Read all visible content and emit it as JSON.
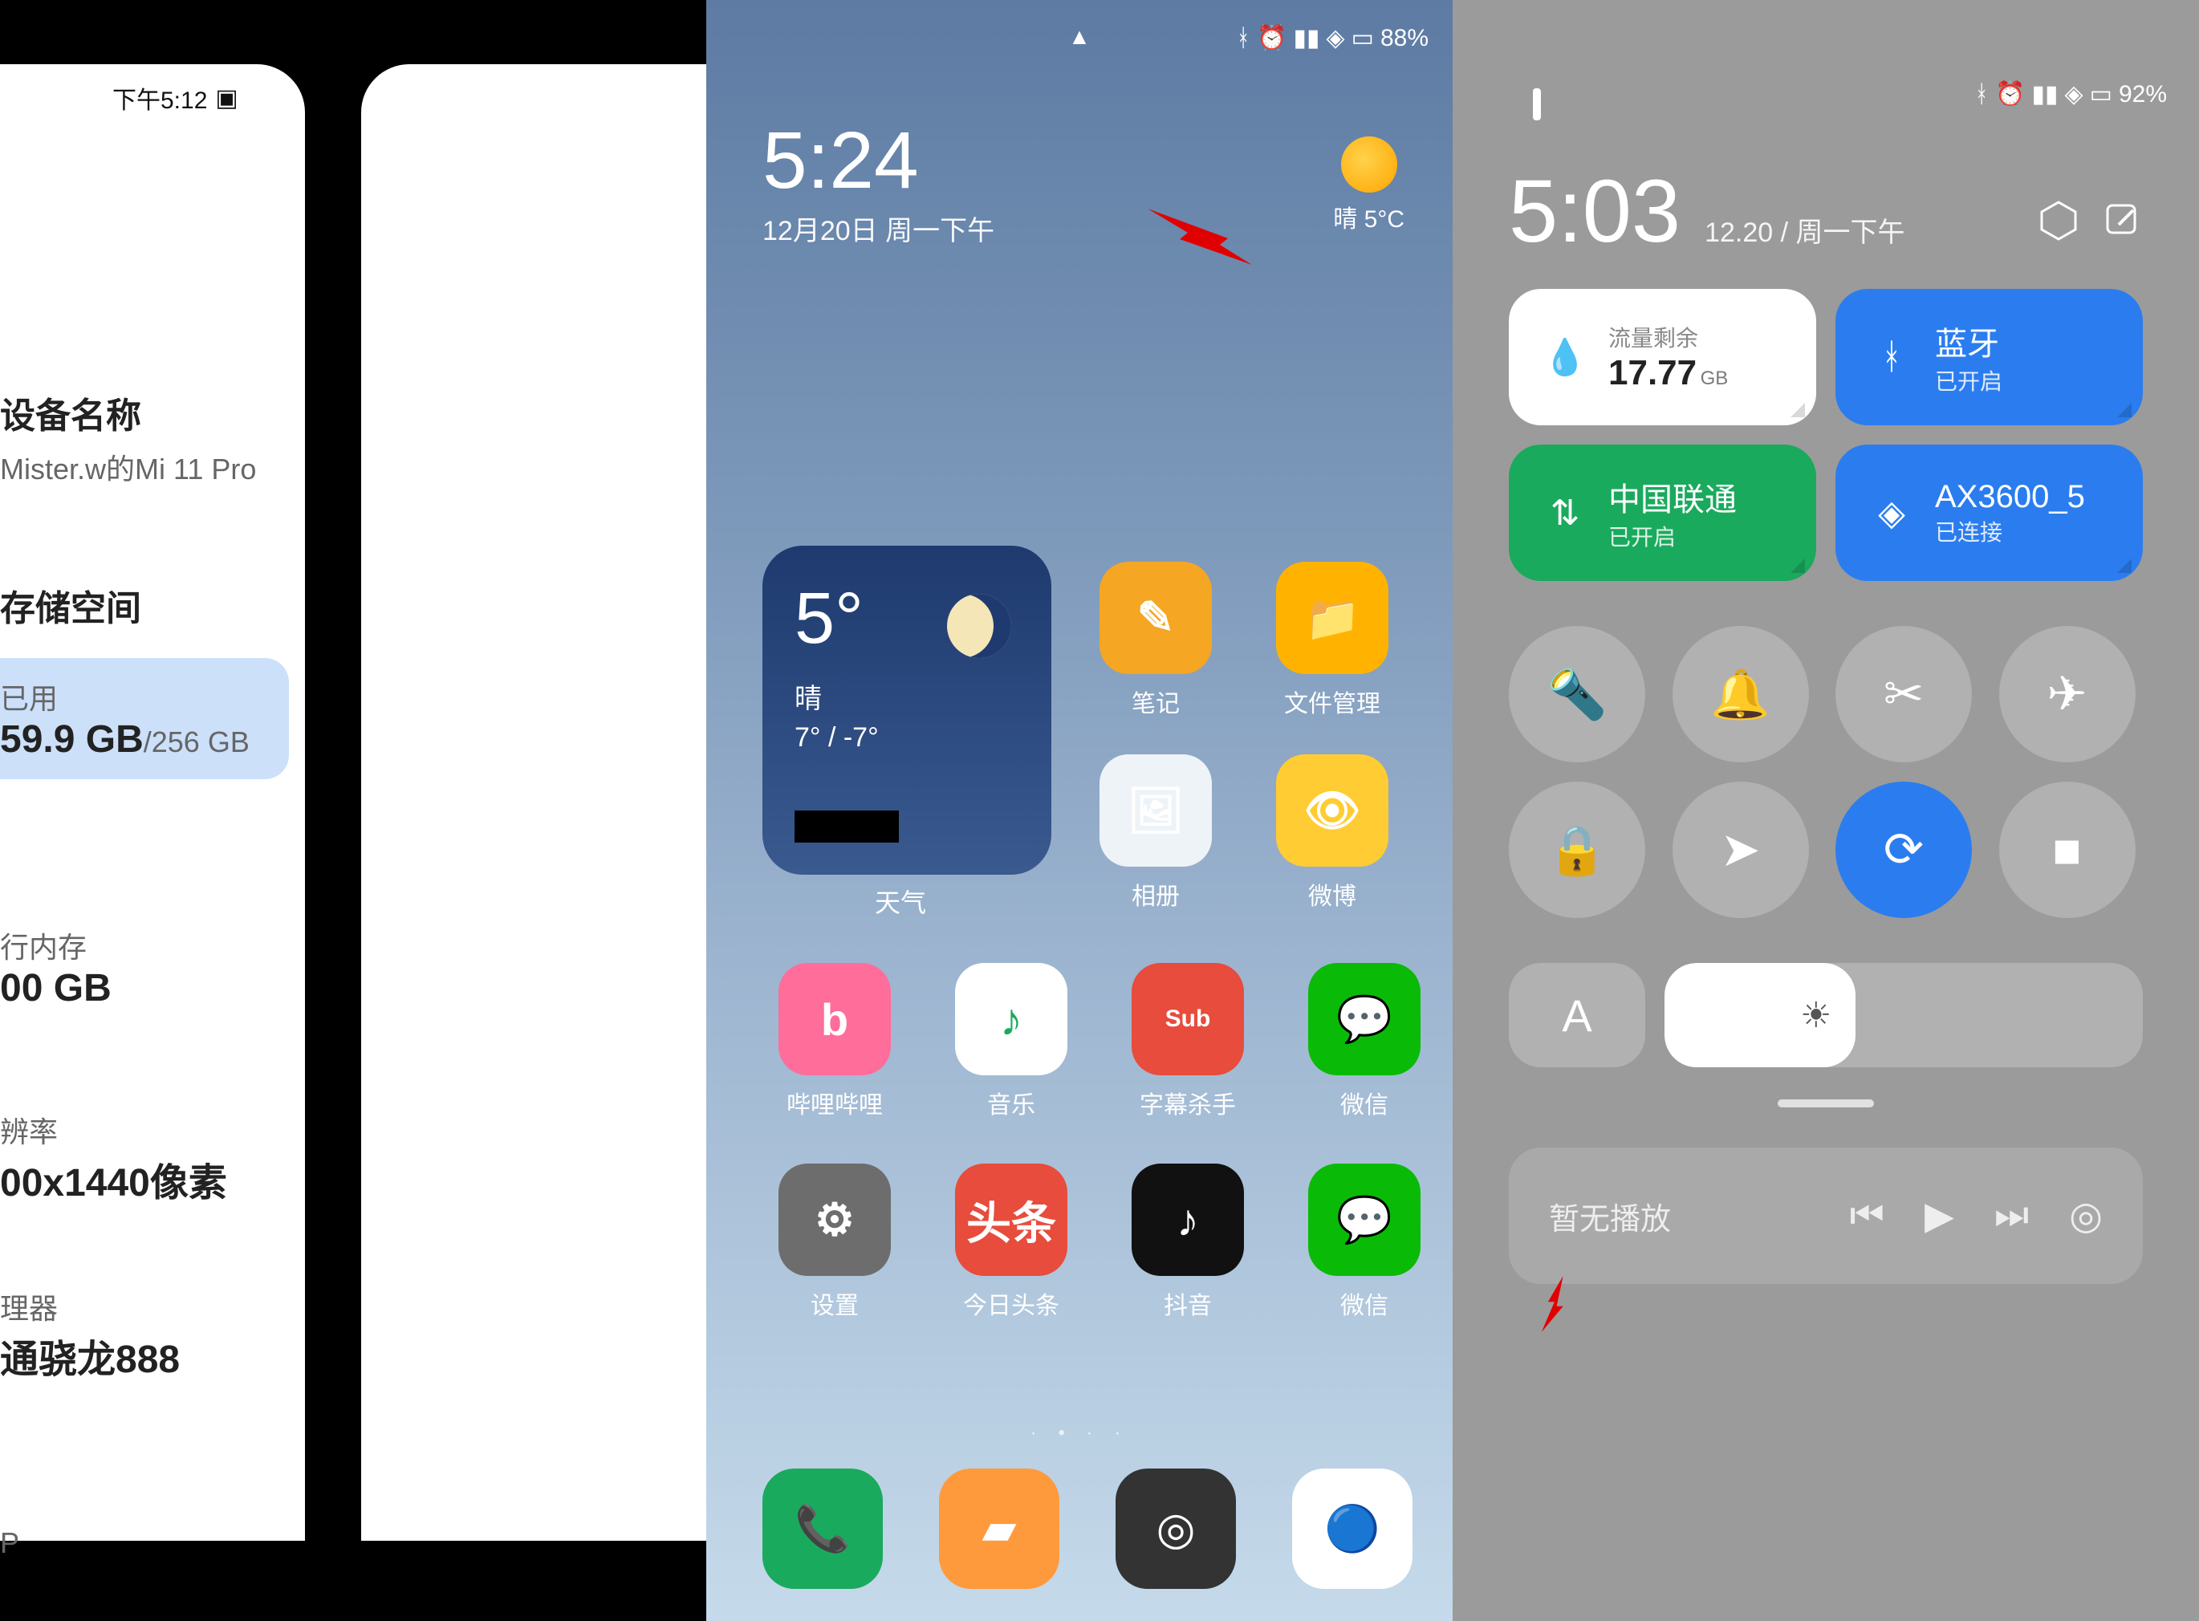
{
  "panel1": {
    "status_time": "下午5:12",
    "device_label": "设备名称",
    "device_value": "Mister.w的Mi 11 Pro",
    "storage_label": "存储空间",
    "storage_used_label": "已用",
    "storage_value": "59.9 GB",
    "storage_total": "/256 GB",
    "ram_label": "行内存",
    "ram_value": "00 GB",
    "resolution_label": "辨率",
    "resolution_value": "00x1440像素",
    "cpu_label": "理器",
    "cpu_value": "通骁龙888",
    "footer": "P"
  },
  "panel2": {
    "status_battery": "88%",
    "clock": "5:24",
    "date": "12月20日 周一下午",
    "weather_mini_label": "晴",
    "weather_mini_temp": "5°C",
    "widget": {
      "temp": "5°",
      "label": "晴",
      "range": "7° / -7°",
      "name": "天气"
    },
    "apps_top": [
      {
        "label": "笔记",
        "bg": "#f5a623",
        "glyph": "✎"
      },
      {
        "label": "文件管理",
        "bg": "#ffb300",
        "glyph": "📁"
      },
      {
        "label": "相册",
        "bg": "#eef3f8",
        "glyph": "🖼"
      },
      {
        "label": "微博",
        "bg": "#ffcc33",
        "glyph": "👁"
      }
    ],
    "apps_row1": [
      {
        "label": "哔哩哔哩",
        "bg": "#ff6d9a",
        "glyph": "b"
      },
      {
        "label": "音乐",
        "bg": "#ffffff",
        "glyph": "♪",
        "fg": "#1aaa5d"
      },
      {
        "label": "字幕杀手",
        "bg": "#e74c3c",
        "glyph": "Sub"
      },
      {
        "label": "微信",
        "bg": "#09bb07",
        "glyph": "💬"
      }
    ],
    "apps_row2": [
      {
        "label": "设置",
        "bg": "#6d6d6d",
        "glyph": "⚙"
      },
      {
        "label": "今日头条",
        "bg": "#e74c3c",
        "glyph": "头条"
      },
      {
        "label": "抖音",
        "bg": "#111",
        "glyph": "♪"
      },
      {
        "label": "微信",
        "bg": "#09bb07",
        "glyph": "💬"
      }
    ],
    "dock": [
      {
        "bg": "#1aaa5d",
        "glyph": "📞"
      },
      {
        "bg": "#ff9a3c",
        "glyph": "▰"
      },
      {
        "bg": "#333",
        "glyph": "◎"
      },
      {
        "bg": "#fff",
        "glyph": "🔵"
      }
    ]
  },
  "panel3": {
    "status_battery": "92%",
    "clock": "5:03",
    "date": "12.20 / 周一下午",
    "tiles": [
      {
        "kind": "data",
        "sub": "流量剩余",
        "value": "17.77",
        "unit": "GB",
        "style": "white",
        "icon": "💧"
      },
      {
        "kind": "toggle",
        "title": "蓝牙",
        "sub": "已开启",
        "style": "blue",
        "icon": "bt"
      },
      {
        "kind": "toggle",
        "title": "中国联通",
        "sub": "已开启",
        "style": "green",
        "icon": "⇅"
      },
      {
        "kind": "toggle",
        "title": "AX3600_5",
        "sub": "已连接",
        "style": "blue",
        "icon": "wifi"
      }
    ],
    "toggles": [
      {
        "name": "flashlight-icon",
        "glyph": "🔦",
        "active": false
      },
      {
        "name": "mute-icon",
        "glyph": "🔔",
        "active": false
      },
      {
        "name": "screenshot-icon",
        "glyph": "✂",
        "active": false
      },
      {
        "name": "airplane-icon",
        "glyph": "✈",
        "active": false
      },
      {
        "name": "lock-icon",
        "glyph": "🔒",
        "active": false
      },
      {
        "name": "location-icon",
        "glyph": "➤",
        "active": false
      },
      {
        "name": "rotation-lock-icon",
        "glyph": "⟳",
        "active": true
      },
      {
        "name": "screen-record-icon",
        "glyph": "■",
        "active": false
      }
    ],
    "auto_brightness": "A",
    "media_label": "暂无播放"
  }
}
